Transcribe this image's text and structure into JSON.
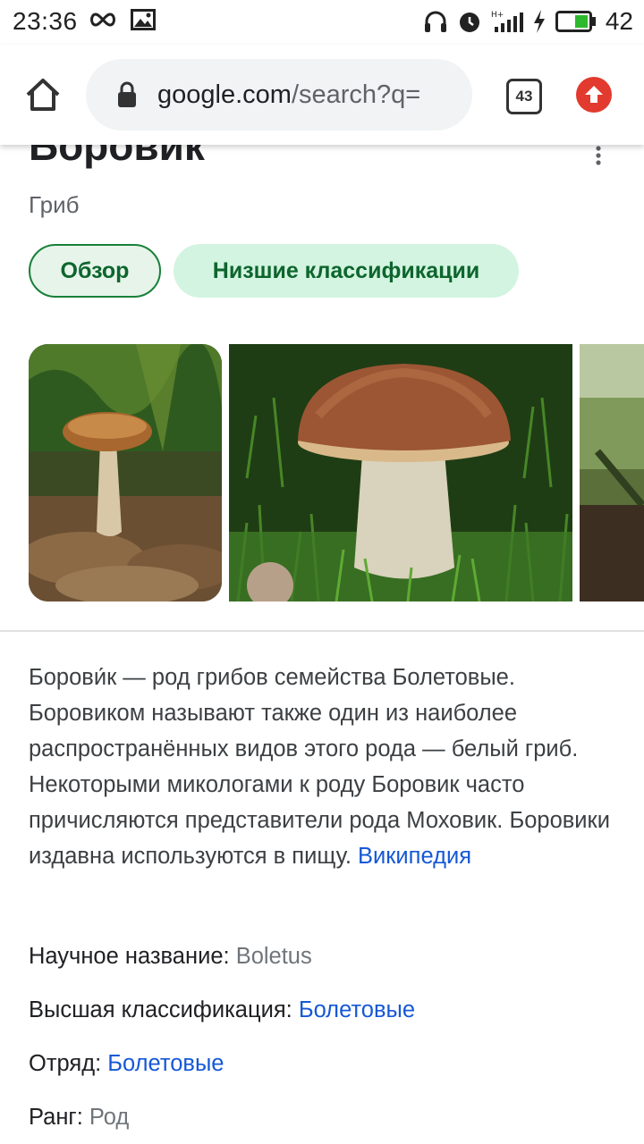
{
  "status": {
    "time": "23:36",
    "battery": "42"
  },
  "address_bar": {
    "domain": "google.com",
    "path": "/search?q=",
    "tabs_count": "43"
  },
  "entity": {
    "title": "Боровик",
    "subtitle": "Гриб",
    "chips": [
      "Обзор",
      "Низшие классификации"
    ]
  },
  "description": {
    "text": "Борови́к — род грибов семейства Болетовые. Боровиком называют также один из наиболее распространённых видов этого рода — белый гриб. Некоторыми микологами к роду Боровик часто причисляются представители рода Моховик. Боровики издавна используются в пищу.",
    "source_link": "Википедия"
  },
  "facts": [
    {
      "label": "Научное название:",
      "value": "Boletus"
    },
    {
      "label": "Высшая классификация:",
      "value": "Болетовые"
    },
    {
      "label": "Отряд:",
      "value": "Болетовые"
    },
    {
      "label": "Ранг:",
      "value": "Род"
    }
  ],
  "colors": {
    "accent_green": "#188038",
    "link_blue": "#1558d6",
    "update_red": "#e23a2e"
  }
}
